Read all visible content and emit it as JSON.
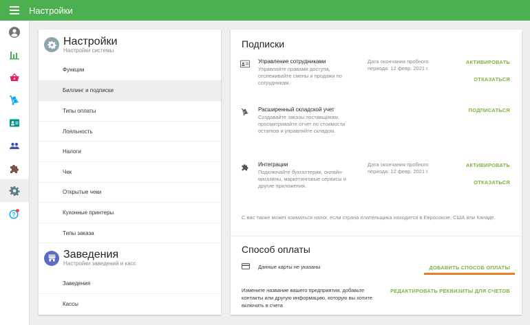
{
  "header": {
    "title": "Настройки"
  },
  "colors": {
    "topbar": "#4caf50",
    "accent_green": "#7cb342",
    "underline_orange": "#e67e22",
    "settings_icon_bg": "#90a4ae",
    "venues_icon_bg": "#5c6bc0"
  },
  "rail": {
    "items": [
      {
        "icon": "account-circle-icon"
      },
      {
        "icon": "bar-chart-icon"
      },
      {
        "icon": "basket-icon"
      },
      {
        "icon": "trolley-icon"
      },
      {
        "icon": "id-card-icon"
      },
      {
        "icon": "people-icon"
      },
      {
        "icon": "puzzle-icon"
      },
      {
        "icon": "gear-icon"
      },
      {
        "icon": "help-icon"
      }
    ]
  },
  "settings": {
    "title": "Настройки",
    "subtitle": "Настройки системы",
    "items": [
      {
        "label": "Функции"
      },
      {
        "label": "Биллинг и подписки"
      },
      {
        "label": "Типы оплаты"
      },
      {
        "label": "Лояльность"
      },
      {
        "label": "Налоги"
      },
      {
        "label": "Чек"
      },
      {
        "label": "Открытые чеки"
      },
      {
        "label": "Кухонные принтеры"
      },
      {
        "label": "Типы заказа"
      }
    ]
  },
  "venues": {
    "title": "Заведения",
    "subtitle": "Настройки заведений и касс",
    "items": [
      {
        "label": "Заведения"
      },
      {
        "label": "Кассы"
      }
    ]
  },
  "subscriptions": {
    "title": "Подписки",
    "items": [
      {
        "title": "Управление сотрудниками",
        "desc": "Управляйте правами доступа, отслеживайте смены и продажи по сотрудникам.",
        "trial": "Дата окончания пробного периода: 12 февр. 2021 г.",
        "primary": "АКТИВИРОВАТЬ",
        "secondary": "ОТКАЗАТЬСЯ"
      },
      {
        "title": "Расширенный складской учет",
        "desc": "Создавайте заказы поставщикам, просматривайте отчет по стоимости остатков и управляйте складом.",
        "primary": "ПОДПИСАТЬСЯ"
      },
      {
        "title": "Интеграции",
        "desc": "Подключайте бухгалтерии, онлайн-магазины, маркетинговые сервисы и другие приложения.",
        "trial": "Дата окончания пробного периода: 12 февр. 2021 г.",
        "primary": "АКТИВИРОВАТЬ",
        "secondary": "ОТКАЗАТЬСЯ"
      }
    ],
    "tax_note": "С вас также может взиматься налог, если страна плательщика находится в Евросоюзе, США или Канаде."
  },
  "payment": {
    "title": "Способ оплаты",
    "card_status": "Данные карты не указаны",
    "add_label": "ДОБАВИТЬ СПОСОБ ОПЛАТЫ",
    "req_text": "Измените название вашего предприятия, добавьте контакты или другую информацию, которую вы хотите включить в счета",
    "edit_label": "РЕДАКТИРОВАТЬ РЕКВИЗИТЫ ДЛЯ СЧЕТОВ"
  }
}
